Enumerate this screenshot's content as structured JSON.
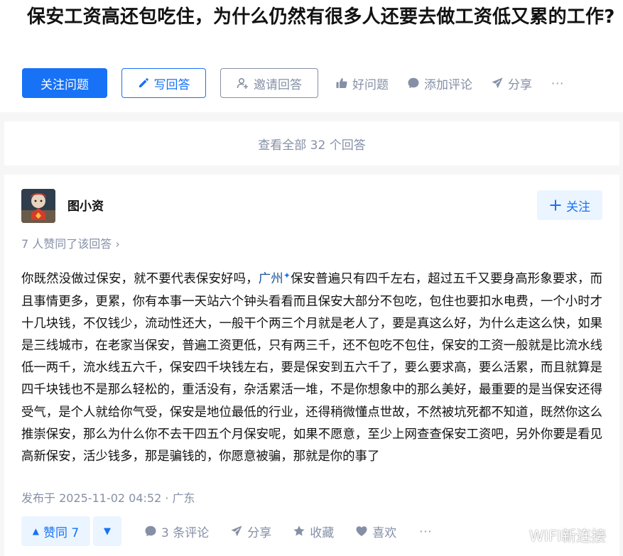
{
  "question": {
    "title": "保安工资高还包吃住，为什么仍然有很多人还要去做工资低又累的工作?"
  },
  "actions": {
    "follow_question": "关注问题",
    "write_answer": "写回答",
    "invite_answer": "邀请回答",
    "good_question": "好问题",
    "add_comment": "添加评论",
    "share": "分享",
    "more": "···"
  },
  "view_all": "查看全部 32 个回答",
  "answer": {
    "author": "图小资",
    "follow_label": "关注",
    "voters_text": "7 人赞同了该回答 ›",
    "content_before_link": "你既然没做过保安，就不要代表保安好吗，",
    "content_link": "广州",
    "content_after_link": "保安普遍只有四千左右，超过五千又要身高形象要求，而且事情更多，更累，你有本事一天站六个钟头看看而且保安大部分不包吃，包住也要扣水电费，一个小时才十几块钱，不仅钱少，流动性还大，一般干个两三个月就是老人了，要是真这么好，为什么走这么快，如果是三线城市，在老家当保安，普遍工资更低，只有两三千，还不包吃不包住，保安的工资一般就是比流水线低一两千，流水线五六千，保安四千块钱左右，要是保安到五六千了，要么要求高，要么活累，而且就算是四千块钱也不是那么轻松的，重活没有，杂活累活一堆，不是你想象中的那么美好，最重要的是当保安还得受气，是个人就给你气受，保安是地位最低的行业，还得稍微懂点世故，不然被坑死都不知道，既然你这么推崇保安，那么为什么你不去干四五个月保安呢，如果不愿意，至少上网查查保安工资吧，另外你要是看见高新保安，活少钱多，那是骗钱的，你愿意被骗，那就是你的事了",
    "published": "发布于 2025-11-02 04:52 · 广东",
    "footer": {
      "vote_up": "赞同 7",
      "comments": "3 条评论",
      "share": "分享",
      "collect": "收藏",
      "like": "喜欢",
      "more": "···"
    }
  },
  "watermark": "WIFI新连接",
  "colors": {
    "brand_blue": "#1772f6",
    "muted_gray": "#8590a6",
    "link_blue": "#175199",
    "vote_bg": "#ebf5ff",
    "page_bg": "#f6f6f6"
  },
  "icons": [
    "pencil-icon",
    "invite-user-icon",
    "thumb-up-icon",
    "comment-bubble-icon",
    "paper-plane-icon",
    "plus-icon",
    "star-icon",
    "heart-icon",
    "sparkle-icon"
  ]
}
